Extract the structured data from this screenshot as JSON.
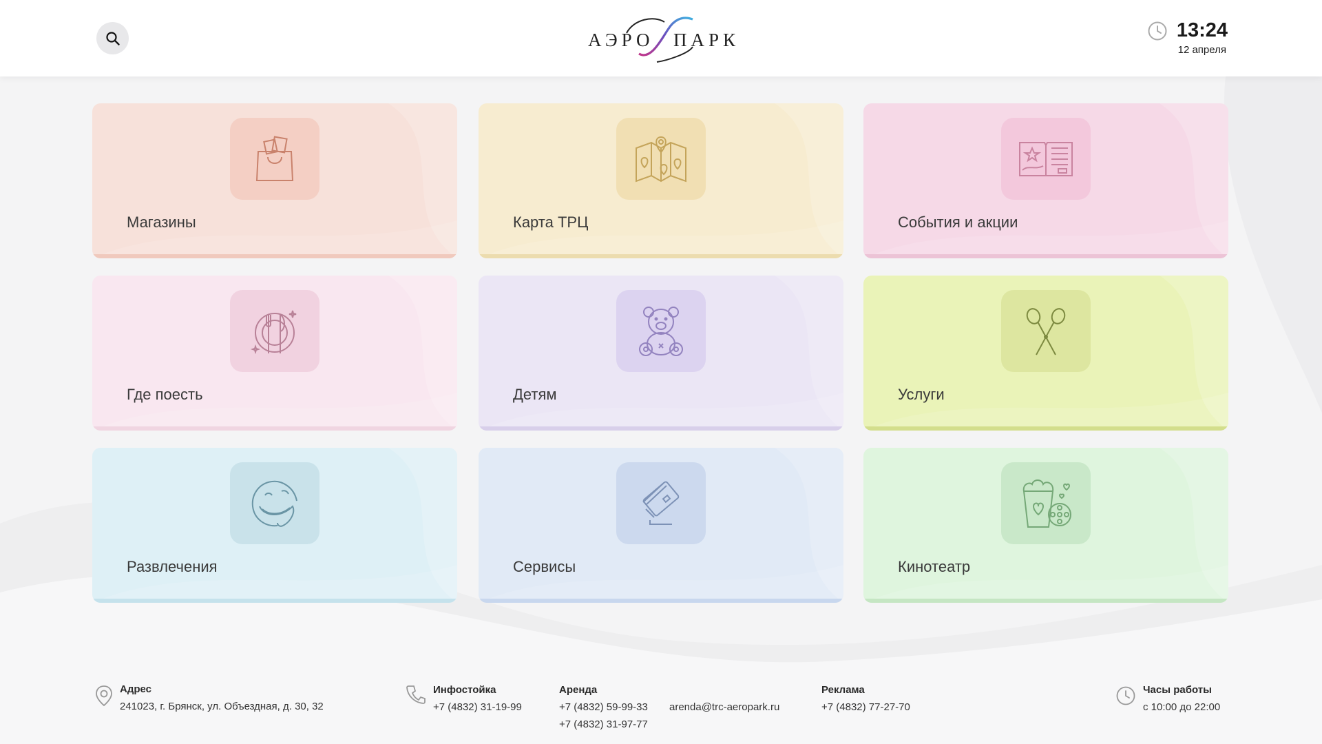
{
  "header": {
    "logo_left": "АЭРО",
    "logo_right": "ПАРК",
    "time": "13:24",
    "date": "12 апреля"
  },
  "tiles": [
    {
      "label": "Магазины",
      "icon": "shopping-bag-icon",
      "bg": "#f7e1da",
      "box": "#f4cfc4",
      "bar": "#f0c9bd",
      "stroke": "#c9826c"
    },
    {
      "label": "Карта ТРЦ",
      "icon": "map-icon",
      "bg": "#f7ecd0",
      "box": "#f1dfb3",
      "bar": "#ecdcae",
      "stroke": "#c4a45a"
    },
    {
      "label": "События и акции",
      "icon": "news-icon",
      "bg": "#f6d9e7",
      "box": "#f3c8dc",
      "bar": "#ecc3d6",
      "stroke": "#c9839f"
    },
    {
      "label": "Где поесть",
      "icon": "dining-icon",
      "bg": "#f9e7f0",
      "box": "#f1d2e0",
      "bar": "#f0d5e1",
      "stroke": "#b88197"
    },
    {
      "label": "Детям",
      "icon": "teddy-bear-icon",
      "bg": "#ebe6f5",
      "box": "#dcd3f0",
      "bar": "#d8cfea",
      "stroke": "#9383bf"
    },
    {
      "label": "Услуги",
      "icon": "scissors-icon",
      "bg": "#eaf3b8",
      "box": "#dde6a0",
      "bar": "#d3de8c",
      "stroke": "#7d8a40"
    },
    {
      "label": "Развлечения",
      "icon": "laughing-face-icon",
      "bg": "#def0f6",
      "box": "#c9e2ea",
      "bar": "#c5e2ec",
      "stroke": "#6a95a5"
    },
    {
      "label": "Сервисы",
      "icon": "credit-card-icon",
      "bg": "#e1eaf6",
      "box": "#ccd9ee",
      "bar": "#c8d7ee",
      "stroke": "#7d92b6"
    },
    {
      "label": "Кинотеатр",
      "icon": "cinema-icon",
      "bg": "#dff5de",
      "box": "#c9e8c9",
      "bar": "#c5e6c3",
      "stroke": "#75a877"
    }
  ],
  "footer": {
    "address_title": "Адрес",
    "address_text": "241023, г. Брянск, ул. Объездная, д. 30, 32",
    "info_title": "Инфостойка",
    "info_phone": "+7 (4832) 31-19-99",
    "rent_title": "Аренда",
    "rent_phone1": "+7 (4832) 59-99-33",
    "rent_phone2": "+7 (4832) 31-97-77",
    "rent_email": "arenda@trc-aeropark.ru",
    "ads_title": "Реклама",
    "ads_phone": "+7 (4832) 77-27-70",
    "hours_title": "Часы работы",
    "hours_text": "с 10:00 до 22:00"
  }
}
